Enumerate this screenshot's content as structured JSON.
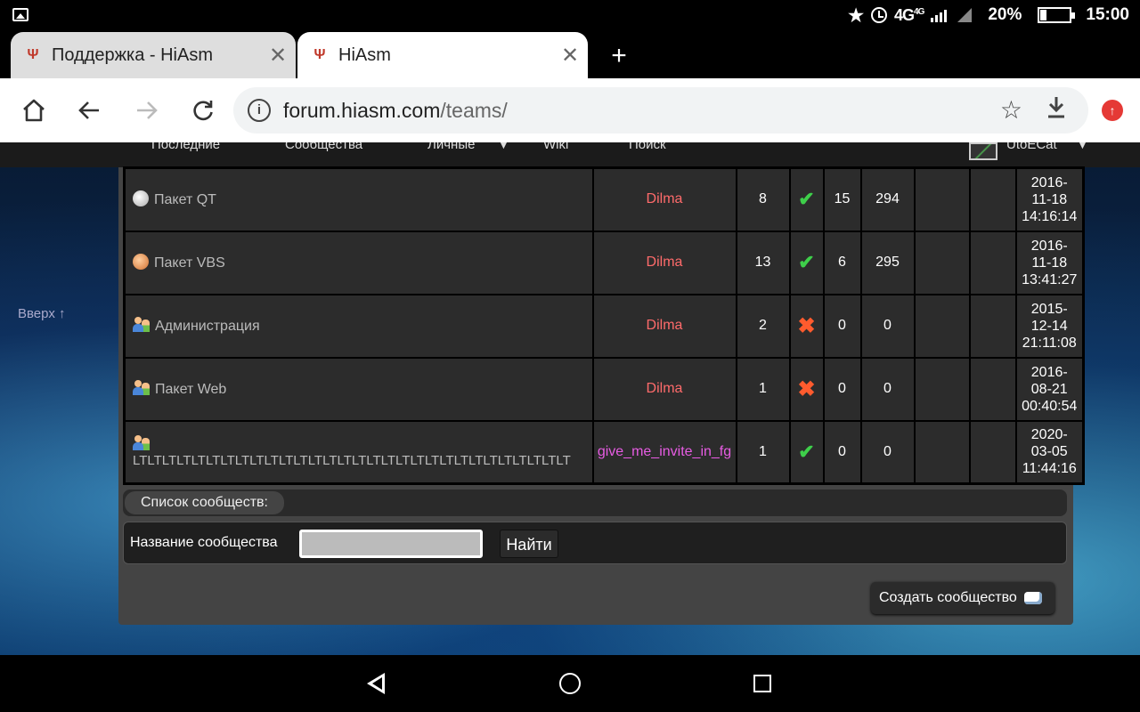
{
  "status_bar": {
    "network": "4G",
    "network_sup": "4G",
    "battery": "20%",
    "time": "15:00"
  },
  "tabs": [
    {
      "title": "Поддержка - HiAsm",
      "favicon": "hiasm-logo-icon"
    },
    {
      "title": "HiAsm",
      "favicon": "hiasm-logo-icon"
    }
  ],
  "omnibox": {
    "url_host": "forum.hiasm.com",
    "url_path": "/teams/"
  },
  "topnav": {
    "items": [
      "Последние",
      "Сообщества",
      "Личные",
      "Wiki",
      "Поиск"
    ],
    "user": "UtoECat"
  },
  "sidebar": {
    "up_link": "Вверх ↑"
  },
  "teams": [
    {
      "name": "Пакет QT",
      "icon": "silver-medal-icon",
      "owner": "Dilma",
      "members": "8",
      "open": true,
      "topics": "15",
      "posts": "294",
      "date": [
        "2016-",
        "11-18",
        "14:16:14"
      ]
    },
    {
      "name": "Пакет VBS",
      "icon": "bronze-medal-icon",
      "owner": "Dilma",
      "members": "13",
      "open": true,
      "topics": "6",
      "posts": "295",
      "date": [
        "2016-",
        "11-18",
        "13:41:27"
      ]
    },
    {
      "name": "Администрация",
      "icon": "users-icon",
      "owner": "Dilma",
      "members": "2",
      "open": false,
      "topics": "0",
      "posts": "0",
      "date": [
        "2015-",
        "12-14",
        "21:11:08"
      ]
    },
    {
      "name": "Пакет Web",
      "icon": "users-icon",
      "owner": "Dilma",
      "members": "1",
      "open": false,
      "topics": "0",
      "posts": "0",
      "date": [
        "2016-",
        "08-21",
        "00:40:54"
      ]
    },
    {
      "name": "LTLTLTLTLTLTLTLTLTLTLTLTLTLTLTLTLTLTLTLTLTLTLTLTLTLTLTLTLTLT",
      "icon": "users-icon",
      "owner": "give_me_invite_in_fg",
      "members": "1",
      "open": true,
      "topics": "0",
      "posts": "0",
      "date": [
        "2020-",
        "03-05",
        "11:44:16"
      ]
    }
  ],
  "list_section": {
    "label": "Список сообществ:"
  },
  "search": {
    "label": "Название сообщества",
    "value": "",
    "button": "Найти"
  },
  "create_button": "Создать сообщество",
  "colors": {
    "owner": "#ff6b6b",
    "owner_special": "#e75ce3",
    "check": "#3ecf4a",
    "cross": "#ff5b2e"
  }
}
